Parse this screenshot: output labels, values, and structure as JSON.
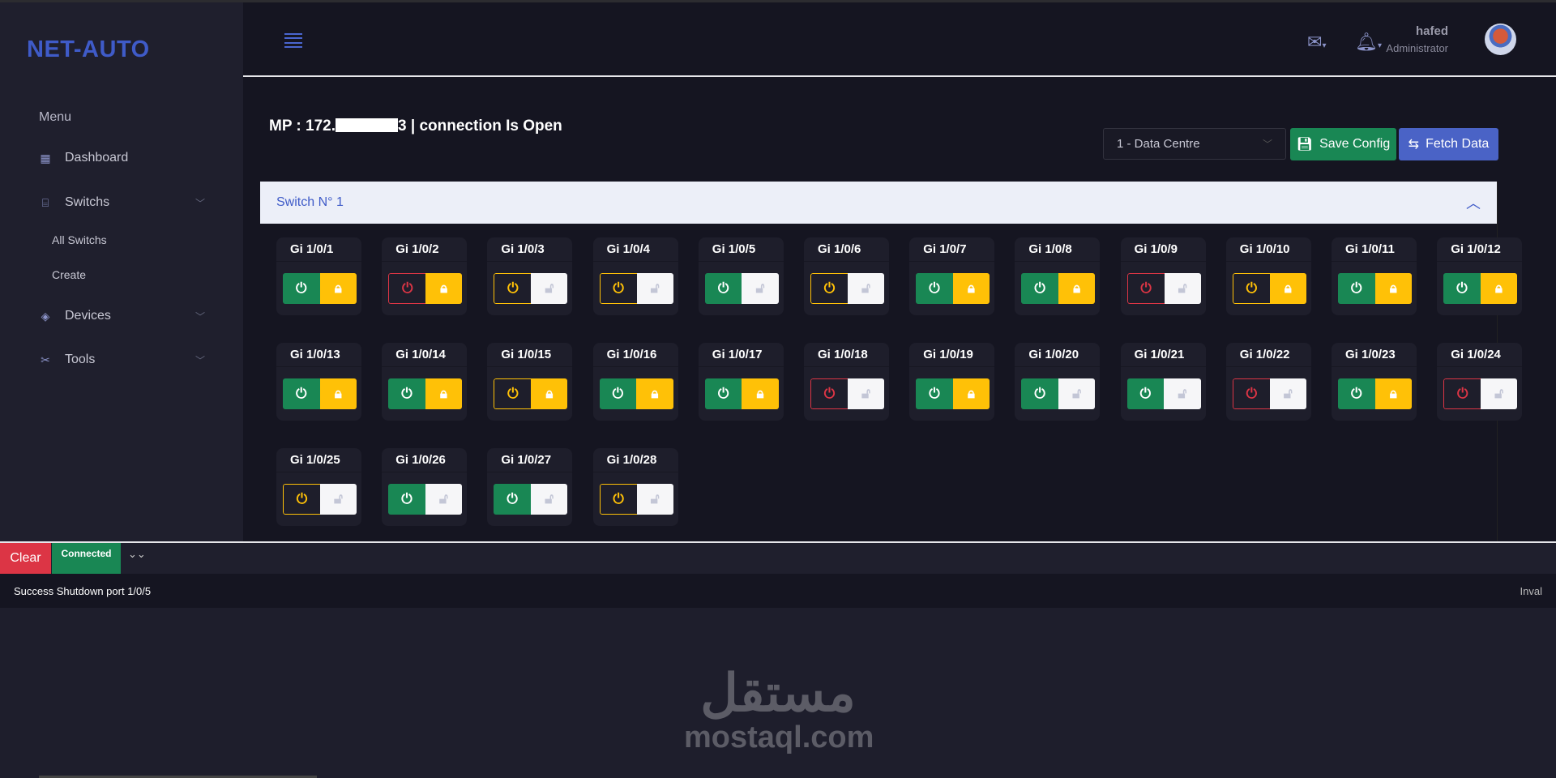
{
  "app": {
    "logo": "NET-AUTO"
  },
  "sidebar": {
    "menu_title": "Menu",
    "items": [
      {
        "label": "Dashboard",
        "icon": "grid-icon"
      },
      {
        "label": "Switchs",
        "icon": "router-icon",
        "children": [
          {
            "label": "All Switchs"
          },
          {
            "label": "Create"
          }
        ]
      },
      {
        "label": "Devices",
        "icon": "layers-icon"
      },
      {
        "label": "Tools",
        "icon": "tools-icon"
      }
    ]
  },
  "header": {
    "user_name": "hafed",
    "user_role": "Administrator"
  },
  "page": {
    "title_prefix": "MP : 172.",
    "title_suffix": "3 | connection Is Open",
    "select_value": "1 - Data Centre",
    "save_label": "Save Config",
    "fetch_label": "Fetch Data"
  },
  "switch": {
    "title": "Switch N° 1",
    "ports": [
      {
        "name": "Gi 1/0/1",
        "power": "up",
        "lock": "locked"
      },
      {
        "name": "Gi 1/0/2",
        "power": "down",
        "lock": "locked"
      },
      {
        "name": "Gi 1/0/3",
        "power": "warn",
        "lock": "unlocked"
      },
      {
        "name": "Gi 1/0/4",
        "power": "warn",
        "lock": "unlocked"
      },
      {
        "name": "Gi 1/0/5",
        "power": "up",
        "lock": "unlocked"
      },
      {
        "name": "Gi 1/0/6",
        "power": "warn",
        "lock": "unlocked"
      },
      {
        "name": "Gi 1/0/7",
        "power": "up",
        "lock": "locked"
      },
      {
        "name": "Gi 1/0/8",
        "power": "up",
        "lock": "locked"
      },
      {
        "name": "Gi 1/0/9",
        "power": "down",
        "lock": "unlocked"
      },
      {
        "name": "Gi 1/0/10",
        "power": "warn",
        "lock": "locked"
      },
      {
        "name": "Gi 1/0/11",
        "power": "up",
        "lock": "locked"
      },
      {
        "name": "Gi 1/0/12",
        "power": "up",
        "lock": "locked"
      },
      {
        "name": "Gi 1/0/13",
        "power": "up",
        "lock": "locked"
      },
      {
        "name": "Gi 1/0/14",
        "power": "up",
        "lock": "locked"
      },
      {
        "name": "Gi 1/0/15",
        "power": "warn",
        "lock": "locked"
      },
      {
        "name": "Gi 1/0/16",
        "power": "up",
        "lock": "locked"
      },
      {
        "name": "Gi 1/0/17",
        "power": "up",
        "lock": "locked"
      },
      {
        "name": "Gi 1/0/18",
        "power": "down",
        "lock": "unlocked"
      },
      {
        "name": "Gi 1/0/19",
        "power": "up",
        "lock": "locked"
      },
      {
        "name": "Gi 1/0/20",
        "power": "up",
        "lock": "unlocked"
      },
      {
        "name": "Gi 1/0/21",
        "power": "up",
        "lock": "unlocked"
      },
      {
        "name": "Gi 1/0/22",
        "power": "down",
        "lock": "unlocked"
      },
      {
        "name": "Gi 1/0/23",
        "power": "up",
        "lock": "locked"
      },
      {
        "name": "Gi 1/0/24",
        "power": "down",
        "lock": "unlocked"
      },
      {
        "name": "Gi 1/0/25",
        "power": "warn",
        "lock": "unlocked"
      },
      {
        "name": "Gi 1/0/26",
        "power": "up",
        "lock": "unlocked"
      },
      {
        "name": "Gi 1/0/27",
        "power": "up",
        "lock": "unlocked"
      },
      {
        "name": "Gi 1/0/28",
        "power": "warn",
        "lock": "unlocked"
      }
    ]
  },
  "console": {
    "clear_label": "Clear",
    "status_label": "Connected",
    "message": "Success Shutdown port 1/0/5",
    "right_text": "Inval"
  },
  "watermark": {
    "arabic": "مستقل",
    "latin": "mostaql.com"
  },
  "colors": {
    "brand": "#3f5bc8",
    "success": "#198754",
    "danger": "#dc3545",
    "warning": "#ffc107"
  }
}
